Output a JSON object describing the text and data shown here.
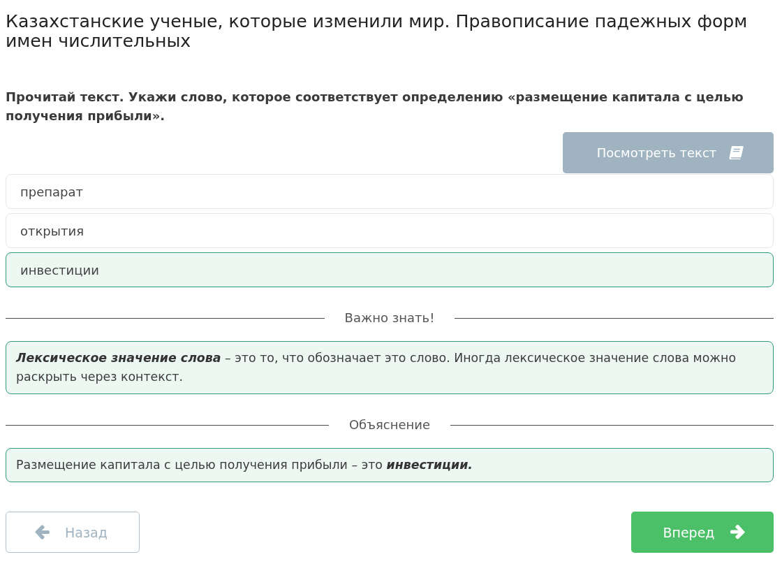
{
  "title": "Казахстанские ученые, которые изменили мир. Правописание падежных форм имен числительных",
  "instruction": "Прочитай текст. Укажи слово, которое соответствует определению «размещение капитала с целью получения прибыли».",
  "view_text_button": {
    "label": "Посмотреть текст"
  },
  "options": [
    {
      "label": "препарат",
      "selected": false
    },
    {
      "label": "открытия",
      "selected": false
    },
    {
      "label": "инвестиции",
      "selected": true
    }
  ],
  "sections": [
    {
      "heading": "Важно знать!",
      "text": "**Лексическое значение слова** – это то, что обозначает это слово. Иногда лексическое значение слова можно раскрыть через контекст."
    },
    {
      "heading": "Объяснение",
      "text": "Размещение капитала с целью получения прибыли – это **инвестиции.**"
    }
  ],
  "navigation": [
    {
      "kind": "back",
      "label": "Назад"
    },
    {
      "kind": "next",
      "label": "Вперед"
    }
  ]
}
